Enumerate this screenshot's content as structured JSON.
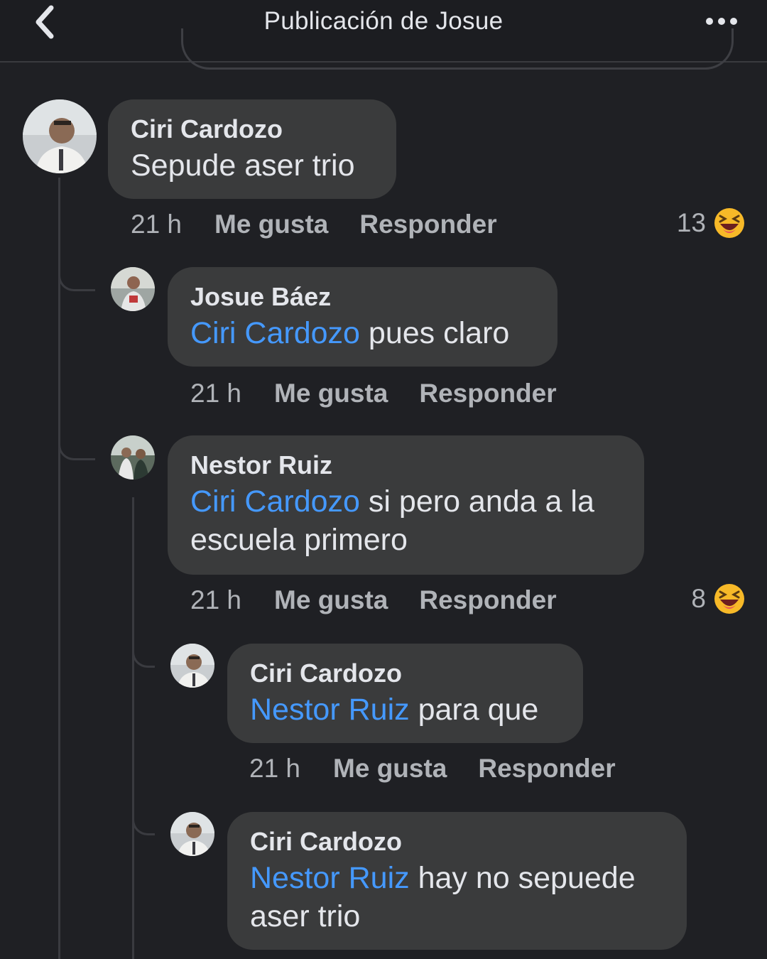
{
  "header": {
    "title": "Publicación de Josue"
  },
  "comments": [
    {
      "author": "Ciri Cardozo",
      "mention": "",
      "text": "Sepude aser trio",
      "time": "21 h",
      "like_label": "Me gusta",
      "reply_label": "Responder",
      "reaction_count": "13",
      "reaction_icon": "laughing-emoji-icon"
    },
    {
      "author": "Josue Báez",
      "mention": "Ciri Cardozo",
      "text": " pues claro",
      "time": "21 h",
      "like_label": "Me gusta",
      "reply_label": "Responder"
    },
    {
      "author": "Nestor Ruiz",
      "mention": "Ciri Cardozo",
      "text": " si pero anda a la escuela primero",
      "time": "21 h",
      "like_label": "Me gusta",
      "reply_label": "Responder",
      "reaction_count": "8",
      "reaction_icon": "laughing-emoji-icon"
    },
    {
      "author": "Ciri Cardozo",
      "mention": "Nestor Ruiz",
      "text": " para que",
      "time": "21 h",
      "like_label": "Me gusta",
      "reply_label": "Responder"
    },
    {
      "author": "Ciri Cardozo",
      "mention": "Nestor Ruiz",
      "text": " hay no sepuede aser trio"
    }
  ],
  "colors": {
    "background": "#1f2024",
    "bubble": "#3a3b3c",
    "mention": "#4599ff",
    "meta_text": "#b0b3b8",
    "reaction": "#f7b928"
  }
}
